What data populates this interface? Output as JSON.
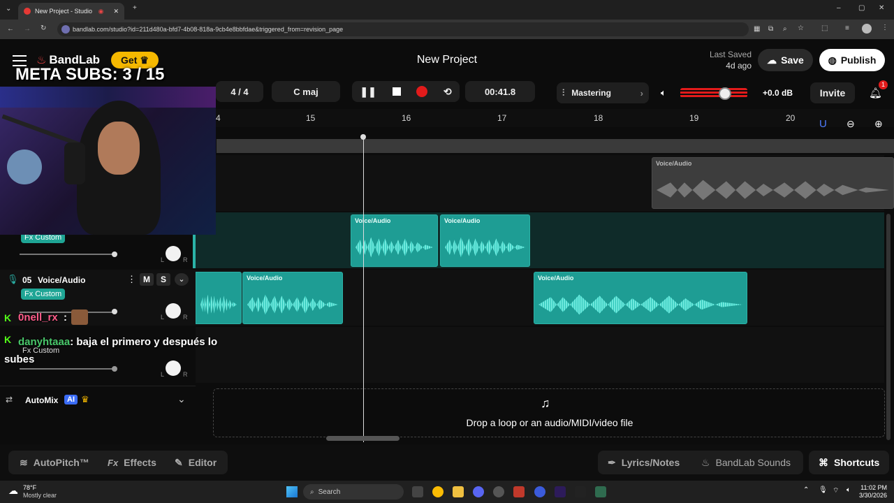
{
  "browser": {
    "tab_title": "New Project - Studio",
    "url": "bandlab.com/studio?id=211d480a-bfd7-4b08-818a-9cb4e8bbfdae&triggered_from=revision_page"
  },
  "header": {
    "logo": "BandLab",
    "get_label": "Get",
    "project_title": "New Project",
    "last_saved_label": "Last Saved",
    "last_saved_value": "4d ago",
    "save_label": "Save",
    "publish_label": "Publish"
  },
  "transport": {
    "time_signature": "4 / 4",
    "key": "C maj",
    "time": "00:41.8",
    "mastering_label": "Mastering",
    "volume_db": "+0.0 dB",
    "invite_label": "Invite",
    "notification_count": "1"
  },
  "ruler": {
    "bars": [
      "4",
      "15",
      "16",
      "17",
      "18",
      "19",
      "20"
    ]
  },
  "tracks": [
    {
      "clip_labels": [
        "Voice/Audio"
      ]
    },
    {
      "fx": "Fx Custom",
      "clip_labels": [
        "Voice/Audio",
        "Voice/Audio"
      ]
    },
    {
      "number": "05",
      "name": "Voice/Audio",
      "fx": "Fx Custom",
      "mute": "M",
      "solo": "S",
      "clip_labels": [
        "Voice/Audio",
        "Voice/Audio"
      ]
    },
    {
      "fx": "Fx Custom"
    }
  ],
  "knob_labels": {
    "left": "L",
    "right": "R"
  },
  "automix": {
    "label": "AutoMix",
    "ai": "AI"
  },
  "dropzone": "Drop a loop or an audio/MIDI/video file",
  "bottom": {
    "autopitch": "AutoPitch™",
    "effects": "Effects",
    "effects_prefix": "Fx",
    "editor": "Editor",
    "lyrics": "Lyrics/Notes",
    "sounds": "BandLab Sounds",
    "shortcuts": "Shortcuts"
  },
  "overlay": {
    "meta_subs": "META SUBS: 3 / 15",
    "chat1_user": "0nell_rx",
    "chat2_user": "danyhtaaa",
    "chat2_text": ": baja el primero y después lo subes"
  },
  "taskbar": {
    "weather_temp": "78°F",
    "weather_desc": "Mostly clear",
    "search": "Search",
    "time": "11:02 PM",
    "date": "3/30/2026"
  },
  "colors": {
    "accent": "#1e9d94",
    "record": "#e21b1b",
    "brand": "#f5b800"
  }
}
